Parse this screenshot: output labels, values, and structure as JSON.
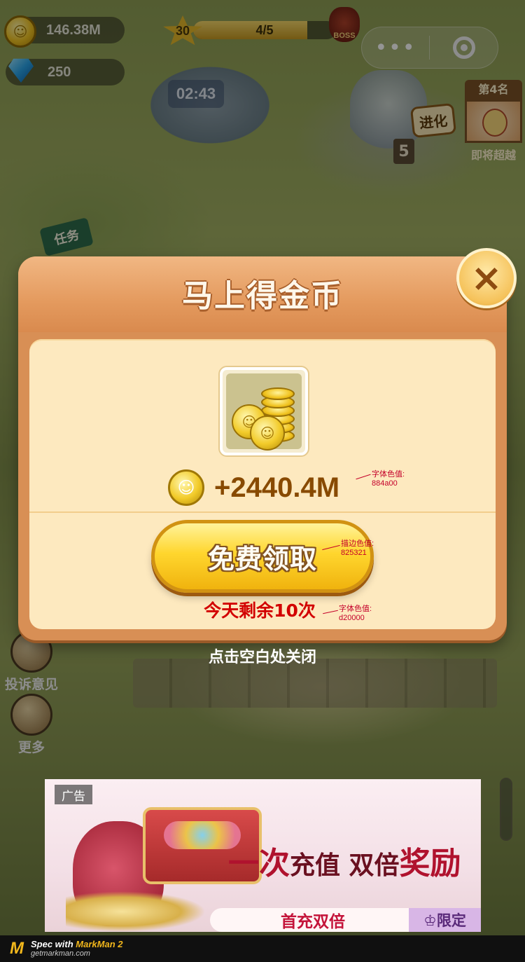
{
  "hud": {
    "coins": "146.38M",
    "gems": "250",
    "level": "30",
    "wave_progress": "4/5",
    "wave_fraction": 0.8,
    "boss_label": "BOSS",
    "timer": "02:43",
    "capsule_more": "•••"
  },
  "scene": {
    "rank_title": "第4名",
    "rank_subtitle": "即将超越",
    "evolve_label": "进化",
    "stage_number": "5",
    "task_label": "任务",
    "side_buttons": [
      {
        "label": "投诉意见",
        "icon": "feedback-icon"
      },
      {
        "label": "更多",
        "icon": "more-icon"
      }
    ]
  },
  "modal": {
    "title": "马上得金币",
    "close_icon": "×",
    "amount": "+2440.4M",
    "claim_label": "免费领取",
    "remaining": "今天剩余10次",
    "tap_close_hint": "点击空白处关闭",
    "amount_color": "#884a00",
    "claim_stroke_color": "#825321",
    "remaining_color": "#d20000"
  },
  "annotations": [
    {
      "label": "字体色值:",
      "value": "884a00"
    },
    {
      "label": "描边色值:",
      "value": "825321"
    },
    {
      "label": "字体色值:",
      "value": "d20000"
    }
  ],
  "ad": {
    "tag": "广告",
    "headline_part1": "一次",
    "headline_part2": "充值",
    "headline_part3": " 双倍",
    "headline_part4": "奖励",
    "bottom_text": "首充双倍",
    "limited": "♔限定"
  },
  "footer": {
    "logo": "M",
    "spec_prefix": "Spec with ",
    "brand": "MarkMan 2",
    "url": "getmarkman.com"
  }
}
